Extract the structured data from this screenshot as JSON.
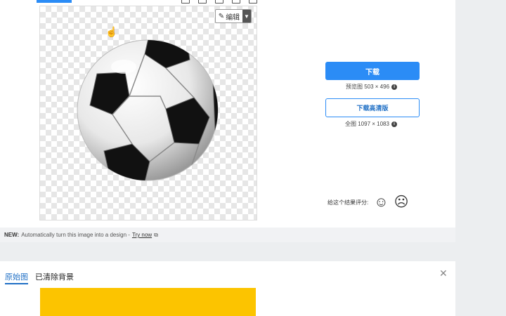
{
  "toolbar": {
    "edit_label": "编辑"
  },
  "download": {
    "button_label": "下载",
    "preview_label": "预览图 503 × 496",
    "hd_button_label": "下载高清版",
    "full_label": "全图 1097 × 1083"
  },
  "rating": {
    "prompt": "给这个结果评分:"
  },
  "banner": {
    "new_label": "NEW:",
    "text": "Automatically turn this image into a design -",
    "link_label": "Try now"
  },
  "bottom": {
    "tabs": [
      {
        "label": "原始图",
        "active": true
      },
      {
        "label": "已清除背景",
        "active": false
      }
    ]
  },
  "colors": {
    "accent": "#2b8cf6",
    "preview_bg": "#fcc400"
  },
  "icons": [
    "pencil-icon",
    "chevron-down-icon",
    "hand-cursor-icon",
    "info-icon",
    "smile-icon",
    "frown-icon",
    "external-link-icon",
    "close-icon"
  ]
}
